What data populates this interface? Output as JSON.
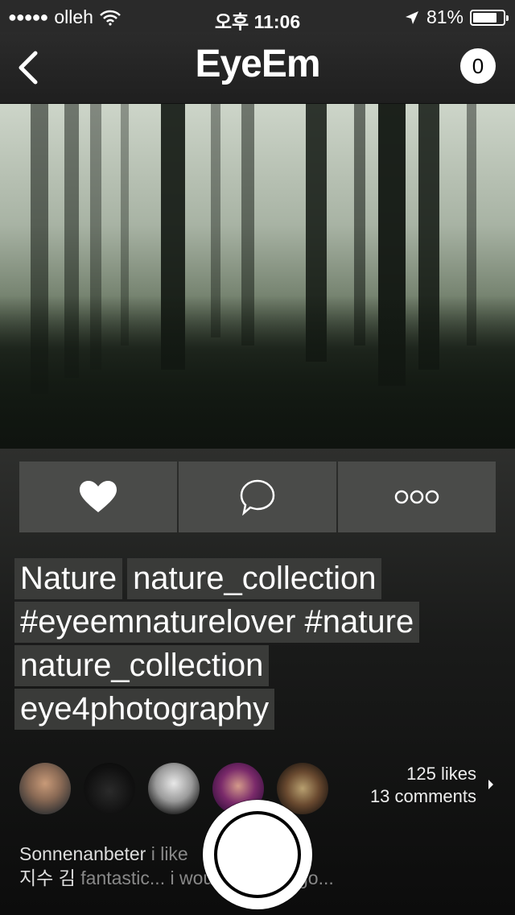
{
  "status_bar": {
    "signal_dots": "●●●●●",
    "carrier": "olleh",
    "time": "오후 11:06",
    "battery_percent": "81%",
    "battery_level": 0.81
  },
  "nav": {
    "title": "EyeEm",
    "badge_count": "0"
  },
  "tags": {
    "rows": [
      [
        "Nature",
        "nature_collection"
      ],
      [
        "#eyeemnaturelover #nature"
      ],
      [
        "nature_collection"
      ],
      [
        "eye4photography"
      ]
    ]
  },
  "stats": {
    "likes": "125 likes",
    "comments": "13 comments"
  },
  "comments": [
    {
      "user": "Sonnenanbeter",
      "text": "i like"
    },
    {
      "user": "지수 김",
      "text": "fantastic... i would want to go..."
    }
  ],
  "colors": {
    "toolbar_bg": "#2a2a2a",
    "button_bg": "#4a4b49",
    "tag_bg": "#3a3b39"
  }
}
